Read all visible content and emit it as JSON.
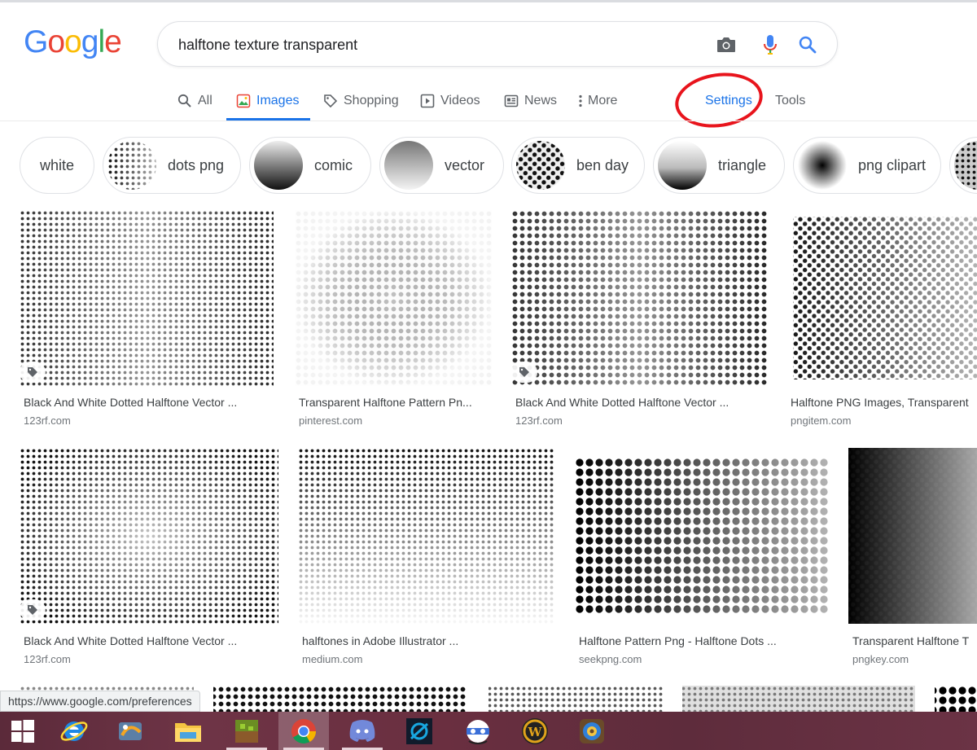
{
  "logo": {
    "letters": [
      "G",
      "o",
      "o",
      "g",
      "l",
      "e"
    ],
    "colors": [
      "#4285f4",
      "#ea4335",
      "#fbbc05",
      "#4285f4",
      "#34a853",
      "#ea4335"
    ]
  },
  "search": {
    "query": "halftone texture transparent",
    "icons": [
      "camera-icon",
      "microphone-icon",
      "search-icon"
    ]
  },
  "tabs": [
    {
      "label": "All",
      "icon": "search-icon",
      "active": false
    },
    {
      "label": "Images",
      "icon": "image-icon",
      "active": true
    },
    {
      "label": "Shopping",
      "icon": "tag-icon",
      "active": false
    },
    {
      "label": "Videos",
      "icon": "play-icon",
      "active": false
    },
    {
      "label": "News",
      "icon": "newspaper-icon",
      "active": false
    },
    {
      "label": "More",
      "icon": "more-vert-icon",
      "active": false
    },
    {
      "label": "Settings",
      "icon": "",
      "active": false
    },
    {
      "label": "Tools",
      "icon": "",
      "active": false
    }
  ],
  "chips": [
    {
      "label": "white"
    },
    {
      "label": "dots png"
    },
    {
      "label": "comic"
    },
    {
      "label": "vector"
    },
    {
      "label": "ben day"
    },
    {
      "label": "triangle"
    },
    {
      "label": "png clipart"
    }
  ],
  "results": [
    {
      "title": "Black And White Dotted Halftone Vector ...",
      "source": "123rf.com",
      "has_tag": true
    },
    {
      "title": "Transparent Halftone Pattern Pn...",
      "source": "pinterest.com",
      "has_tag": false
    },
    {
      "title": "Black And White Dotted Halftone Vector ...",
      "source": "123rf.com",
      "has_tag": true
    },
    {
      "title": "Halftone PNG Images, Transparent",
      "source": "pngitem.com",
      "has_tag": false
    },
    {
      "title": "Black And White Dotted Halftone Vector ...",
      "source": "123rf.com",
      "has_tag": true
    },
    {
      "title": "halftones in Adobe Illustrator ...",
      "source": "medium.com",
      "has_tag": false
    },
    {
      "title": "Halftone Pattern Png - Halftone Dots ...",
      "source": "seekpng.com",
      "has_tag": false
    },
    {
      "title": "Transparent Halftone T",
      "source": "pngkey.com",
      "has_tag": false
    }
  ],
  "status_url": "https://www.google.com/preferences",
  "taskbar": {
    "items": [
      "windows-start-icon",
      "internet-explorer-icon",
      "media-app-icon",
      "file-explorer-icon",
      "minecraft-icon",
      "chrome-icon",
      "discord-icon",
      "battlenet-icon",
      "vpn-app-icon",
      "world-of-warcraft-icon",
      "hearthstone-icon"
    ],
    "colors": {
      "bg": "#6a2f40"
    }
  },
  "colors": {
    "accent": "#1a73e8",
    "annotation": "#e8141c",
    "text_secondary": "#5f6368"
  }
}
